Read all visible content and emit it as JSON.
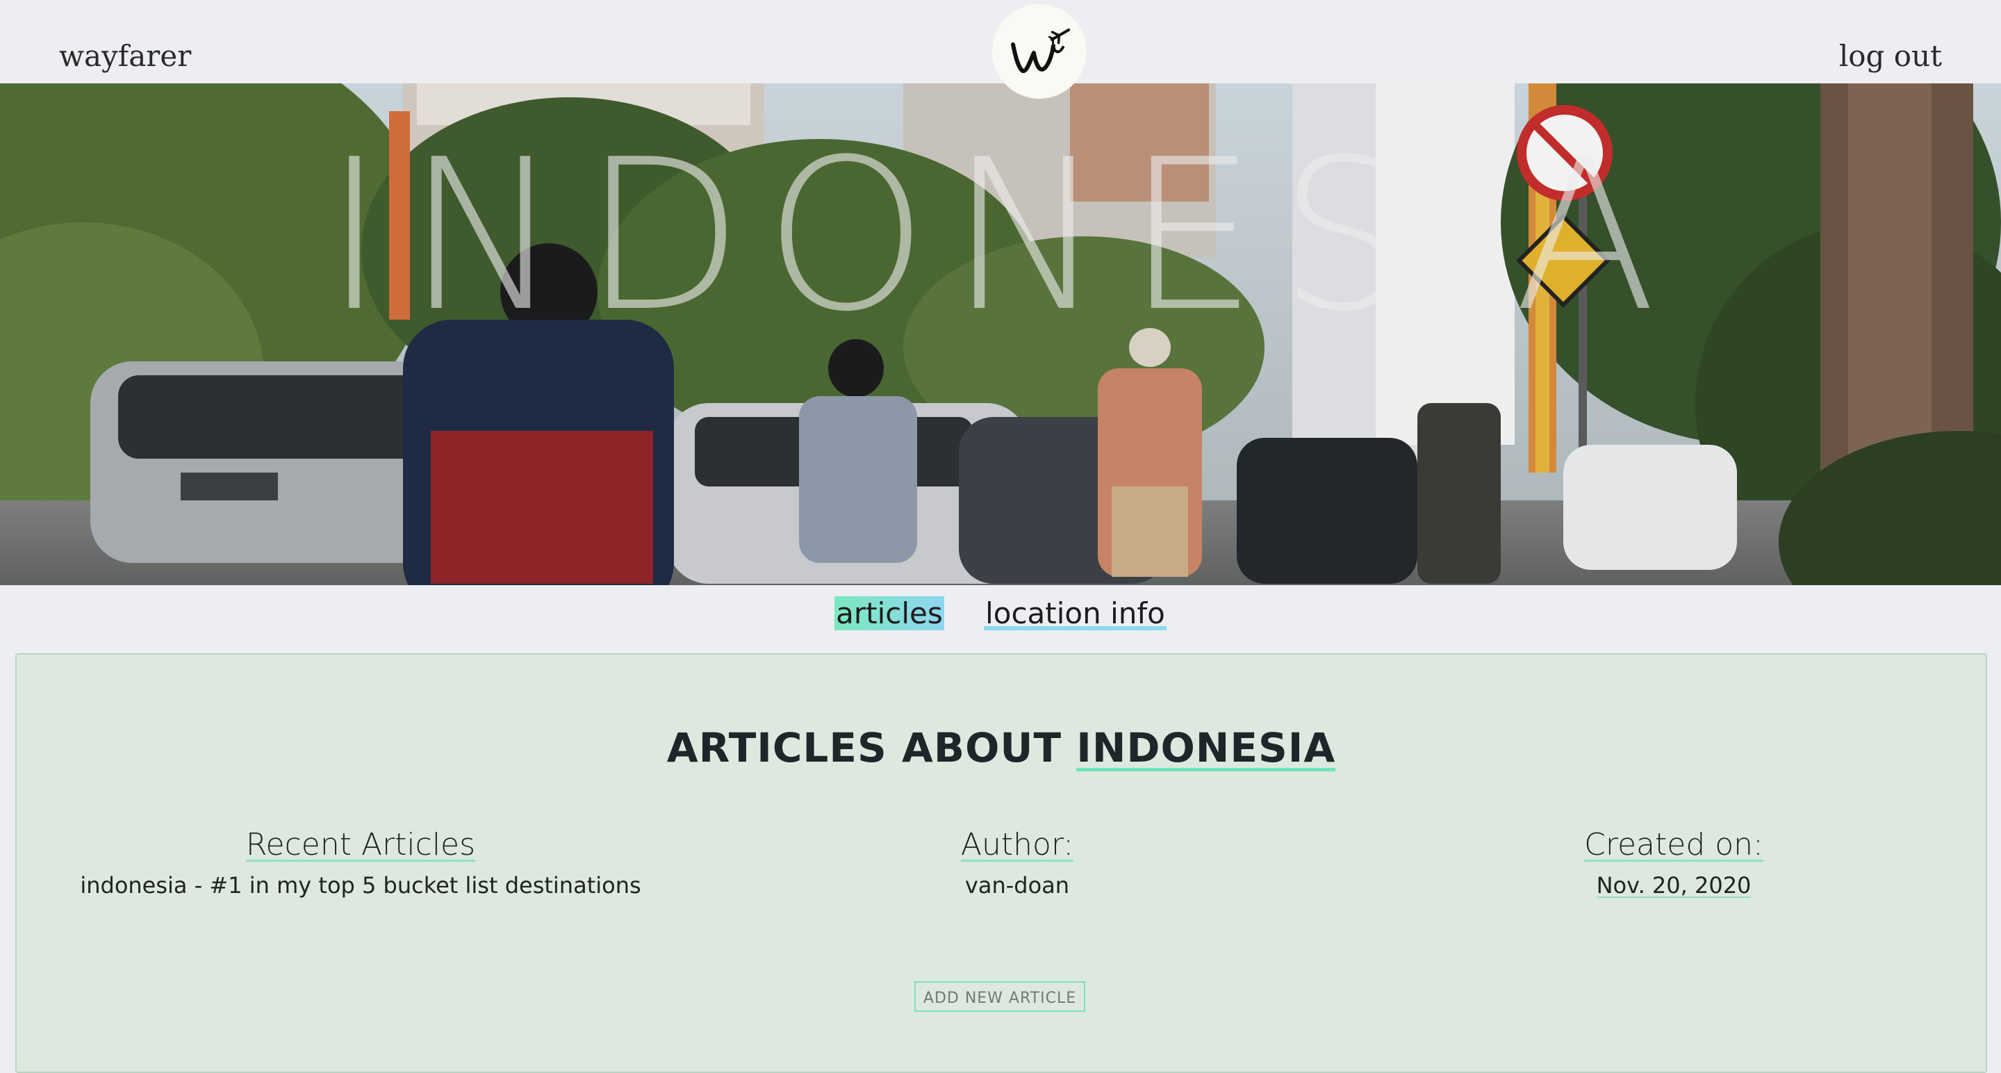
{
  "header": {
    "brand": "wayfarer",
    "logout_label": "log out",
    "logo_icon": "wayfarer-w-airplane-logo"
  },
  "hero": {
    "title": "INDONESIA",
    "image": "street-scene-traffic-photo"
  },
  "tabs": [
    {
      "label": "articles",
      "active": true
    },
    {
      "label": "location info",
      "active": false
    }
  ],
  "panel": {
    "heading_prefix": "ARTICLES ABOUT ",
    "heading_place": "INDONESIA",
    "columns": {
      "articles": {
        "header": "Recent Articles",
        "items": [
          "indonesia - #1 in my top 5 bucket list destinations"
        ]
      },
      "author": {
        "header": "Author:",
        "items": [
          "van-doan"
        ]
      },
      "created": {
        "header": "Created on:",
        "items": [
          "Nov. 20, 2020"
        ]
      }
    },
    "add_button_label": "ADD NEW ARTICLE"
  },
  "colors": {
    "page_bg": "#eceef2",
    "panel_bg": "#dde9df",
    "accent_mint": "#7ce8c0",
    "accent_sky": "#8ed5ee"
  }
}
